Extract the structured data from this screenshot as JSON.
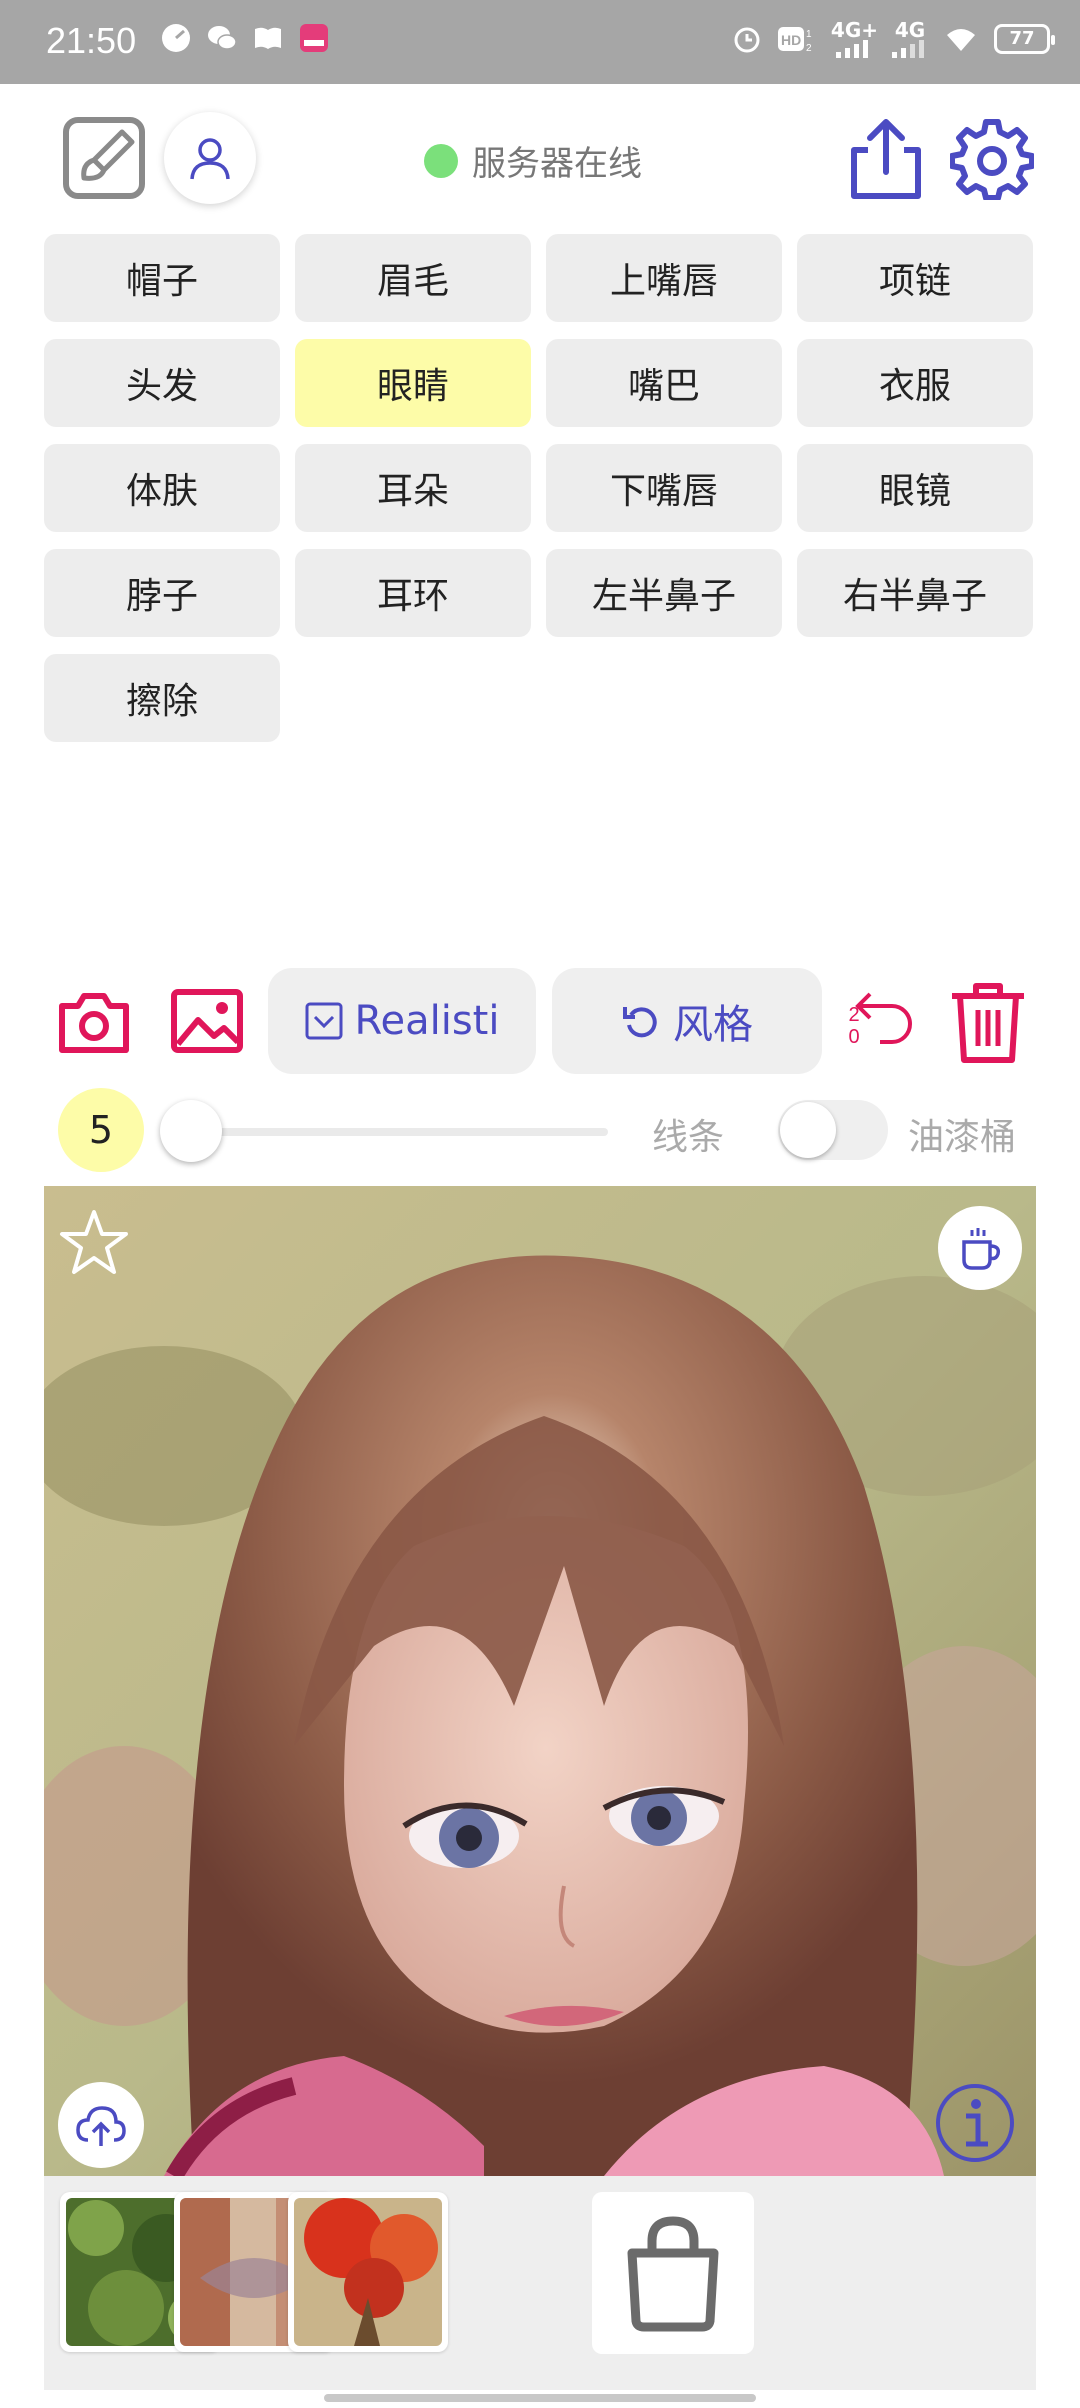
{
  "status_bar": {
    "time": "21:50",
    "network_1": "4G+",
    "network_2": "4G",
    "battery": "77",
    "icons": [
      "speed-icon",
      "wechat-icon",
      "book-icon",
      "app-badge-icon",
      "alarm-icon",
      "hd-icon",
      "signal-icon",
      "wifi-icon",
      "battery-icon"
    ]
  },
  "header": {
    "server_status": "服务器在线",
    "online_color": "#7be07b",
    "accent": "#4b4bc2"
  },
  "labels": [
    {
      "text": "帽子",
      "selected": false
    },
    {
      "text": "眉毛",
      "selected": false
    },
    {
      "text": "上嘴唇",
      "selected": false
    },
    {
      "text": "项链",
      "selected": false
    },
    {
      "text": "头发",
      "selected": false
    },
    {
      "text": "眼睛",
      "selected": true
    },
    {
      "text": "嘴巴",
      "selected": false
    },
    {
      "text": "衣服",
      "selected": false
    },
    {
      "text": "体肤",
      "selected": false
    },
    {
      "text": "耳朵",
      "selected": false
    },
    {
      "text": "下嘴唇",
      "selected": false
    },
    {
      "text": "眼镜",
      "selected": false
    },
    {
      "text": "脖子",
      "selected": false
    },
    {
      "text": "耳环",
      "selected": false
    },
    {
      "text": "左半鼻子",
      "selected": false
    },
    {
      "text": "右半鼻子",
      "selected": false
    },
    {
      "text": "擦除",
      "selected": false
    }
  ],
  "toolbar": {
    "style_label": "Realisti",
    "restyle_label": "风格",
    "undo_count_top": "2",
    "undo_count_bottom": "0",
    "danger_color": "#e0165a"
  },
  "brush": {
    "size": "5",
    "slider_fraction": 0.0,
    "line_label": "线条",
    "bucket_label": "油漆桶",
    "bucket_enabled": false
  },
  "canvas": {
    "subject": "doll portrait",
    "tools": [
      "star-icon",
      "coffee-cup-icon",
      "cloud-upload-icon",
      "info-icon"
    ]
  },
  "references": [
    {
      "name": "green-foliage-thumb"
    },
    {
      "name": "lace-fabric-thumb"
    },
    {
      "name": "red-leaves-thumb"
    }
  ]
}
